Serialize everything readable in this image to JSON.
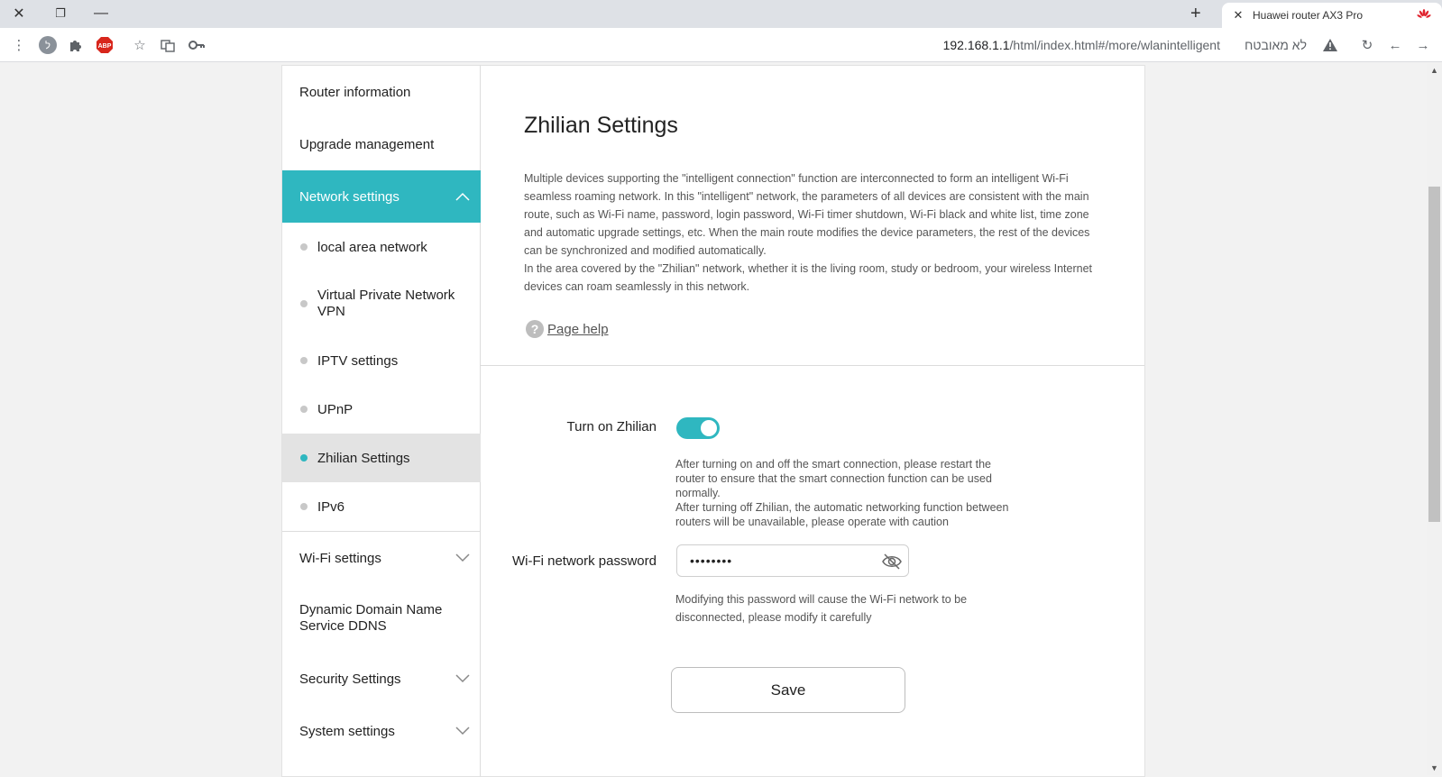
{
  "browser": {
    "tab_title": "Huawei router AX3 Pro",
    "url_host": "192.168.1.1",
    "url_path": "/html/index.html#/more/wlanintelligent",
    "security_label": "לא מאובטח",
    "abp_label": "ABP"
  },
  "sidebar": {
    "items": [
      {
        "label": "Router information"
      },
      {
        "label": "Upgrade management"
      },
      {
        "label": "Network settings"
      },
      {
        "label": "Wi-Fi settings"
      },
      {
        "label": "Dynamic Domain Name Service DDNS"
      },
      {
        "label": "Security Settings"
      },
      {
        "label": "System settings"
      }
    ],
    "sub_items": [
      {
        "label": "local area network"
      },
      {
        "label": "Virtual Private Network VPN"
      },
      {
        "label": "IPTV settings"
      },
      {
        "label": "UPnP"
      },
      {
        "label": "Zhilian Settings"
      },
      {
        "label": "IPv6"
      }
    ]
  },
  "main": {
    "title": "Zhilian Settings",
    "description_1": "Multiple devices supporting the \"intelligent connection\" function are interconnected to form an intelligent Wi-Fi seamless roaming network. In this \"intelligent\" network, the parameters of all devices are consistent with the main route, such as Wi-Fi name, password, login password, Wi-Fi timer shutdown, Wi-Fi black and white list, time zone and automatic upgrade settings, etc. When the main route modifies the device parameters, the rest of the devices can be synchronized and modified automatically.",
    "description_2": "In the area covered by the \"Zhilian\" network, whether it is the living room, study or bedroom, your wireless Internet devices can roam seamlessly in this network.",
    "help_label": "Page help",
    "turn_on_label": "Turn on Zhilian",
    "toggle_on": true,
    "toggle_note_1": "After turning on and off the smart connection, please restart the router to ensure that the smart connection function can be used normally.",
    "toggle_note_2": "After turning off Zhilian, the automatic networking function between routers will be unavailable, please operate with caution",
    "password_label": "Wi-Fi network password",
    "password_value": "••••••••",
    "password_note": "Modifying this password will cause the Wi-Fi network to be disconnected, please modify it carefully",
    "save_label": "Save"
  },
  "colors": {
    "accent": "#2fb7c0",
    "selected_bg": "#e3e3e3"
  }
}
